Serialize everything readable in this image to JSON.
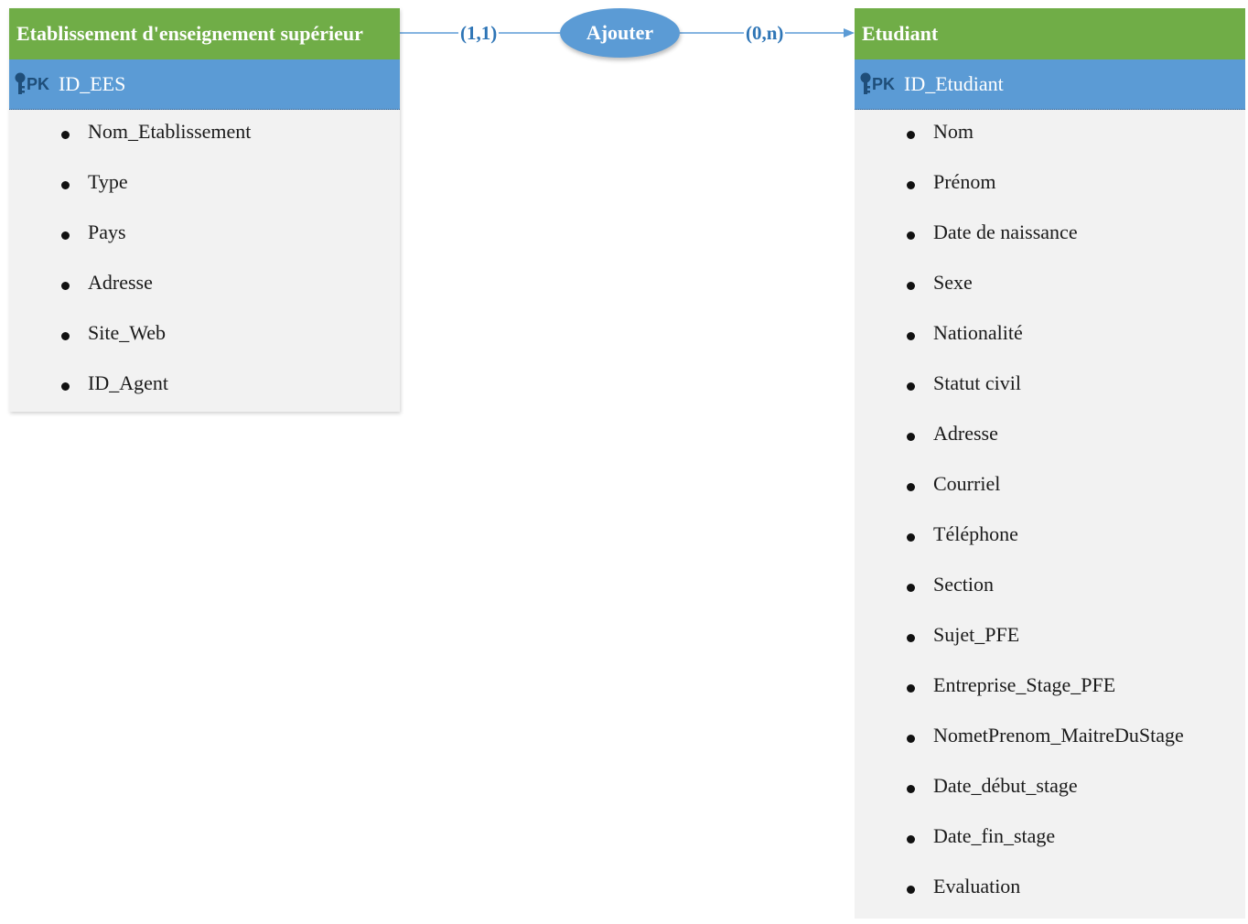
{
  "entities": {
    "ees": {
      "title": "Etablissement d'enseignement supérieur",
      "pk_marker": "PK",
      "primary_key": "ID_EES",
      "attributes": [
        "Nom_Etablissement",
        "Type",
        "Pays",
        "Adresse",
        "Site_Web",
        "ID_Agent"
      ]
    },
    "etudiant": {
      "title": "Etudiant",
      "pk_marker": "PK",
      "primary_key": "ID_Etudiant",
      "attributes": [
        "Nom",
        "Prénom",
        "Date de naissance",
        "Sexe",
        "Nationalité",
        "Statut civil",
        "Adresse",
        "Courriel",
        "Téléphone",
        "Section",
        "Sujet_PFE",
        "Entreprise_Stage_PFE",
        "NometPrenom_MaitreDuStage",
        "Date_début_stage",
        "Date_fin_stage",
        "Evaluation"
      ]
    }
  },
  "relationship": {
    "label": "Ajouter",
    "cardinality_left": "(1,1)",
    "cardinality_right": "(0,n)"
  },
  "colors": {
    "header_green": "#70ad47",
    "pk_blue": "#5b9bd5",
    "body_gray": "#f2f2f2",
    "connector_blue": "#5b9bd5",
    "cardinality_text": "#2e75b6"
  },
  "icons": {
    "primary_key": "key-icon"
  }
}
